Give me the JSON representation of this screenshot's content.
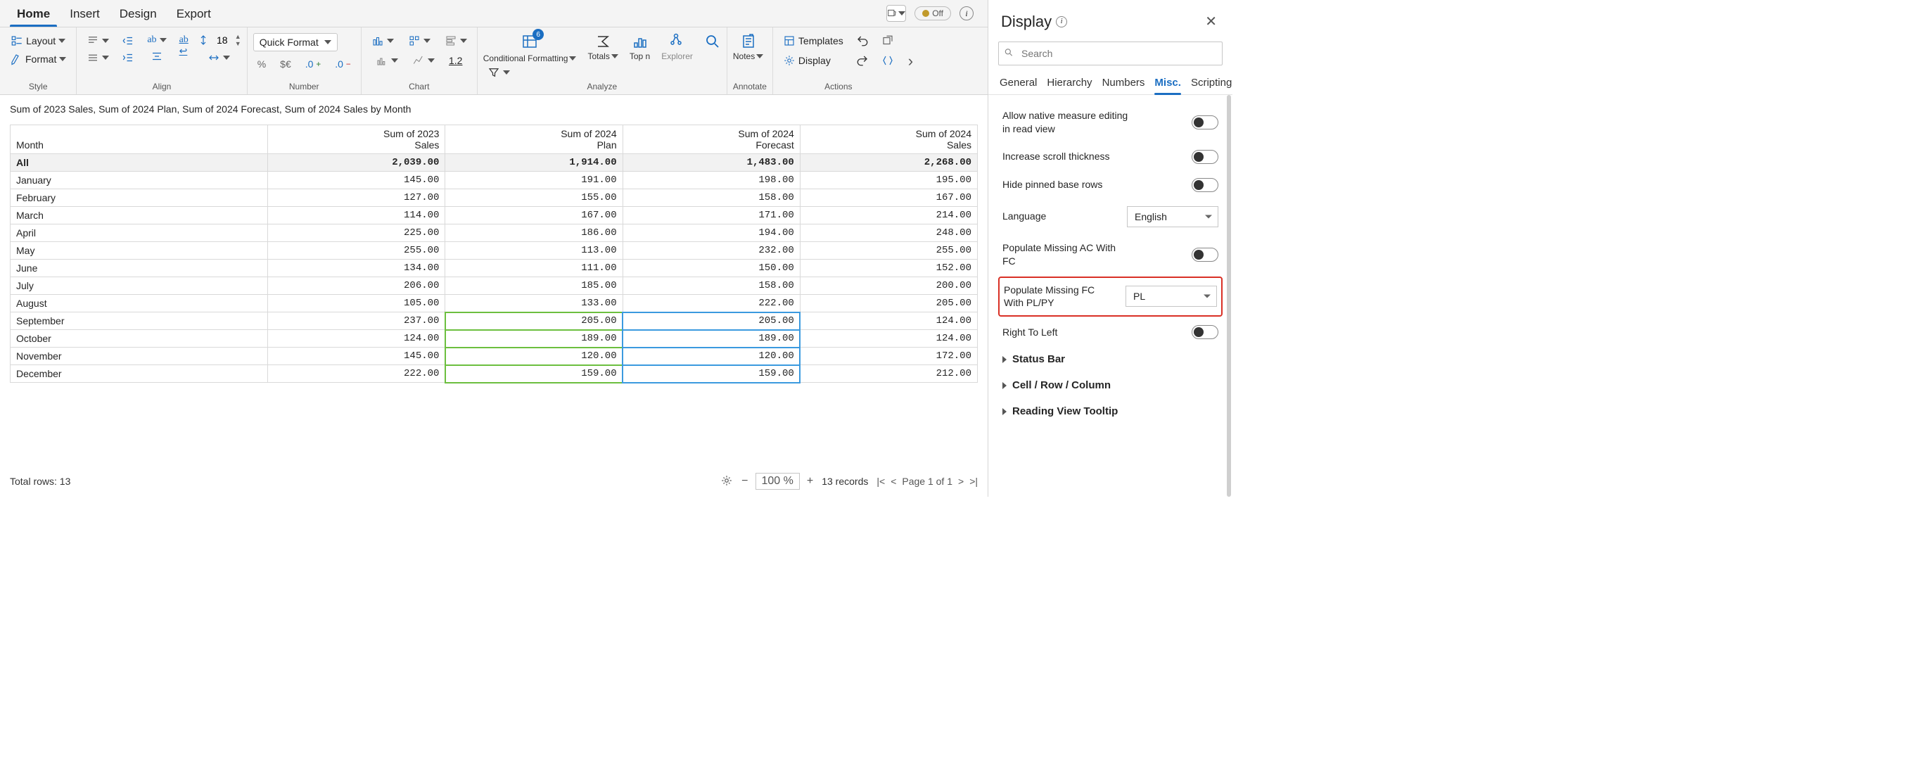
{
  "app_tabs": [
    "Home",
    "Insert",
    "Design",
    "Export"
  ],
  "active_tab": "Home",
  "autosave": "Off",
  "ribbon": {
    "layout": "Layout",
    "format": "Format",
    "quick_format": "Quick Format",
    "font_size": "18",
    "decimal_btn": "1.2",
    "cond_fmt": "Conditional Formatting",
    "cond_badge": "6",
    "totals": "Totals",
    "topn": "Top n",
    "explorer": "Explorer",
    "notes": "Notes",
    "templates": "Templates",
    "display": "Display",
    "groups": {
      "style": "Style",
      "align": "Align",
      "number": "Number",
      "chart": "Chart",
      "analyze": "Analyze",
      "annotate": "Annotate",
      "actions": "Actions"
    }
  },
  "report": {
    "title": "Sum of 2023 Sales, Sum of 2024 Plan, Sum of 2024 Forecast, Sum of 2024 Sales by Month",
    "columns": [
      "Month",
      "Sum of 2023 Sales",
      "Sum of 2024 Plan",
      "Sum of 2024 Forecast",
      "Sum of 2024 Sales"
    ],
    "all_row": [
      "All",
      "2,039.00",
      "1,914.00",
      "1,483.00",
      "2,268.00"
    ],
    "rows": [
      [
        "January",
        "145.00",
        "191.00",
        "198.00",
        "195.00"
      ],
      [
        "February",
        "127.00",
        "155.00",
        "158.00",
        "167.00"
      ],
      [
        "March",
        "114.00",
        "167.00",
        "171.00",
        "214.00"
      ],
      [
        "April",
        "225.00",
        "186.00",
        "194.00",
        "248.00"
      ],
      [
        "May",
        "255.00",
        "113.00",
        "232.00",
        "255.00"
      ],
      [
        "June",
        "134.00",
        "111.00",
        "150.00",
        "152.00"
      ],
      [
        "July",
        "206.00",
        "185.00",
        "158.00",
        "200.00"
      ],
      [
        "August",
        "105.00",
        "133.00",
        "222.00",
        "205.00"
      ],
      [
        "September",
        "237.00",
        "205.00",
        "205.00",
        "124.00"
      ],
      [
        "October",
        "124.00",
        "189.00",
        "189.00",
        "124.00"
      ],
      [
        "November",
        "145.00",
        "120.00",
        "120.00",
        "172.00"
      ],
      [
        "December",
        "222.00",
        "159.00",
        "159.00",
        "212.00"
      ]
    ]
  },
  "footer": {
    "total_rows": "Total rows: 13",
    "zoom": "100 %",
    "records": "13 records",
    "page": "Page 1 of 1"
  },
  "panel": {
    "title": "Display",
    "search_placeholder": "Search",
    "tabs": [
      "General",
      "Hierarchy",
      "Numbers",
      "Misc.",
      "Scripting"
    ],
    "active_tab": "Misc.",
    "options": {
      "native_edit": "Allow native measure editing in read view",
      "scroll": "Increase scroll thickness",
      "hide_pinned": "Hide pinned base rows",
      "language_label": "Language",
      "language_value": "English",
      "pop_ac": "Populate Missing AC With FC",
      "pop_fc_label": "Populate Missing FC With PL/PY",
      "pop_fc_value": "PL",
      "rtl": "Right To Left",
      "statusbar": "Status Bar",
      "cellrow": "Cell / Row / Column",
      "reading": "Reading View Tooltip"
    }
  }
}
